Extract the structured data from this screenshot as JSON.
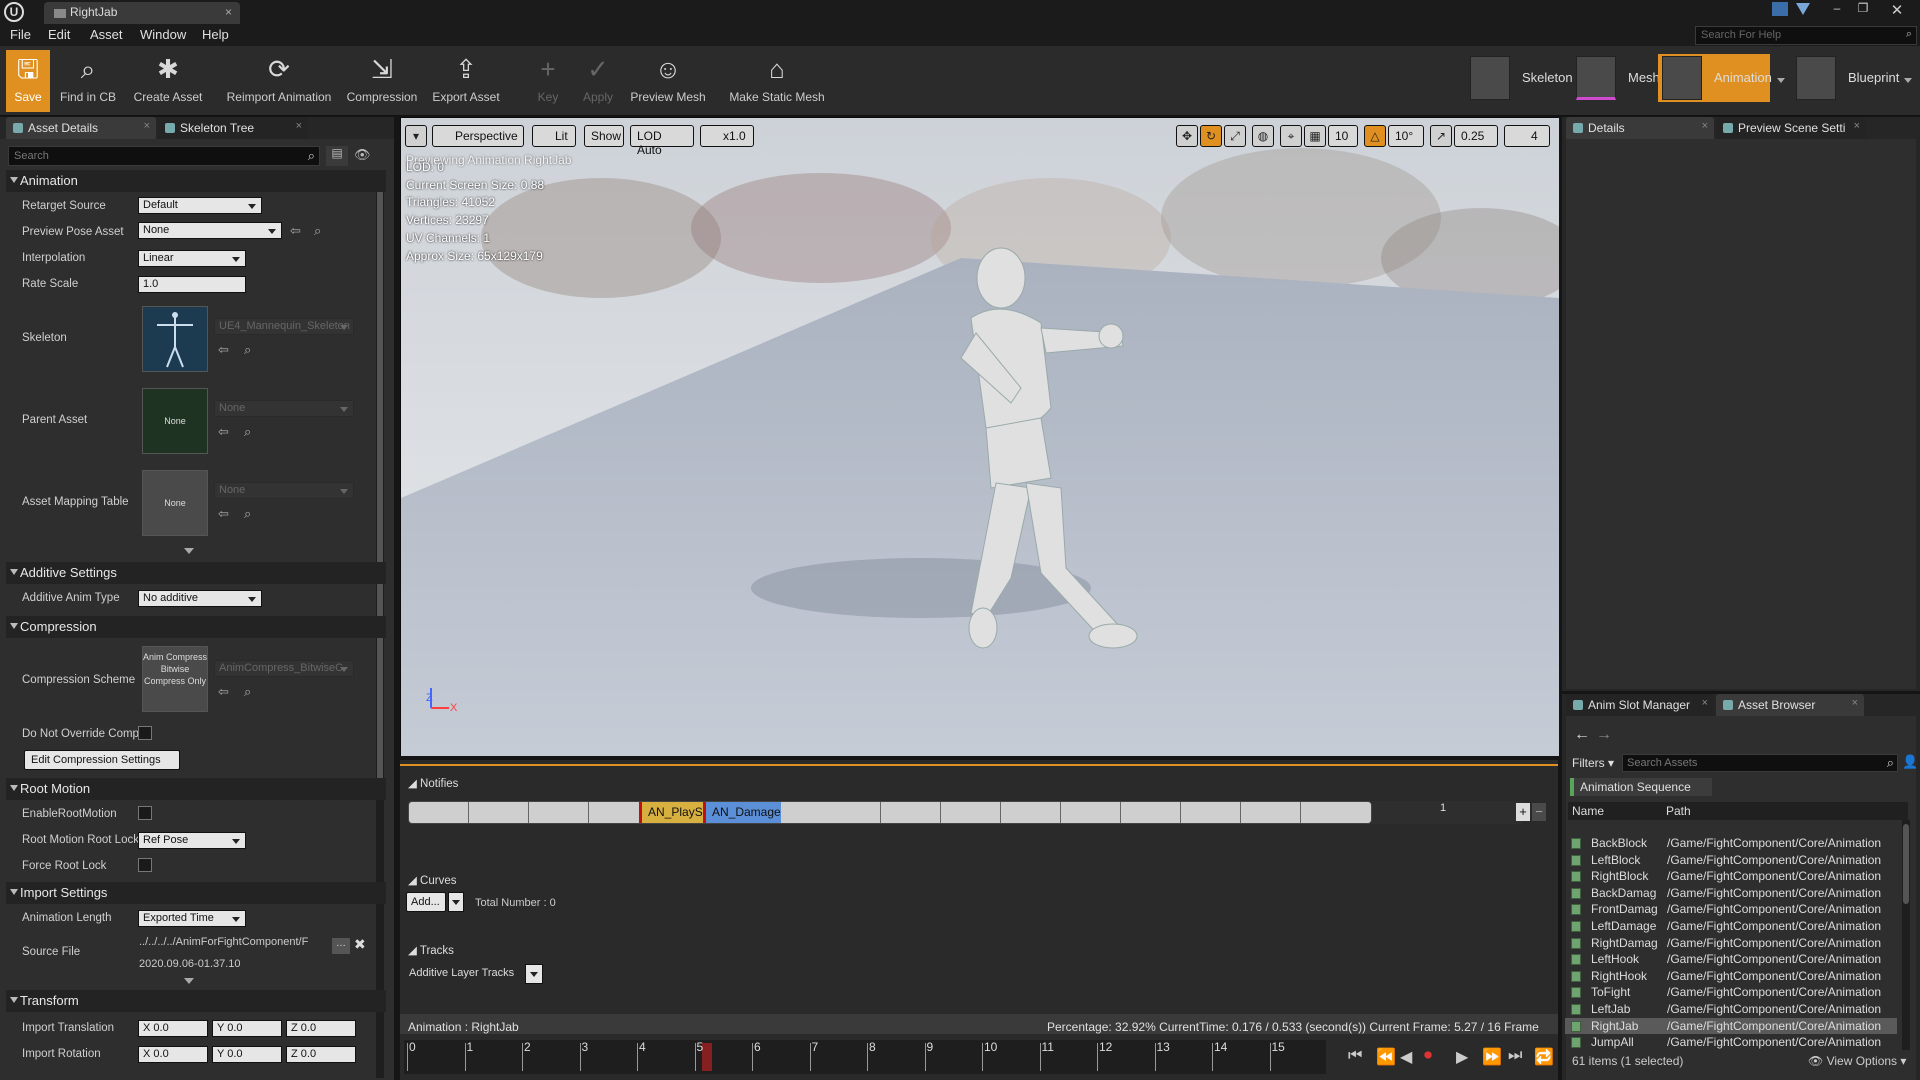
{
  "window": {
    "title": "RightJab"
  },
  "menu": [
    "File",
    "Edit",
    "Asset",
    "Window",
    "Help"
  ],
  "help_search_placeholder": "Search For Help",
  "toolbar": [
    "Save",
    "Find in CB",
    "Create Asset",
    "Reimport Animation",
    "Compression",
    "Export Asset",
    "Key",
    "Apply",
    "Preview Mesh",
    "Make Static Mesh"
  ],
  "modes": [
    "Skeleton",
    "Mesh",
    "Animation",
    "Blueprint"
  ],
  "left_panel": {
    "tabs": [
      "Asset Details",
      "Skeleton Tree"
    ],
    "search_placeholder": "Search",
    "sections": {
      "animation": "Animation",
      "additive": "Additive Settings",
      "compression": "Compression",
      "root_motion": "Root Motion",
      "import": "Import Settings",
      "transform": "Transform"
    },
    "props": {
      "retarget_source": {
        "label": "Retarget Source",
        "value": "Default"
      },
      "preview_pose": {
        "label": "Preview Pose Asset",
        "value": "None"
      },
      "interpolation": {
        "label": "Interpolation",
        "value": "Linear"
      },
      "rate_scale": {
        "label": "Rate Scale",
        "value": "1.0"
      },
      "skeleton": {
        "label": "Skeleton",
        "value": "UE4_Mannequin_Skeleton"
      },
      "parent_asset": {
        "label": "Parent Asset",
        "value": "None",
        "thumb": "None"
      },
      "asset_mapping": {
        "label": "Asset Mapping Table",
        "value": "None",
        "thumb": "None"
      },
      "additive_type": {
        "label": "Additive Anim Type",
        "value": "No additive"
      },
      "compression_scheme": {
        "label": "Compression Scheme",
        "value": "AnimCompress_BitwiseC",
        "thumb": "Anim Compress Bitwise Compress Only"
      },
      "do_not_override": {
        "label": "Do Not Override Comp"
      },
      "edit_compression": "Edit Compression Settings",
      "enable_root_motion": {
        "label": "EnableRootMotion"
      },
      "root_motion_lock": {
        "label": "Root Motion Root Lock",
        "value": "Ref Pose"
      },
      "force_root_lock": {
        "label": "Force Root Lock"
      },
      "anim_length": {
        "label": "Animation Length",
        "value": "Exported Time"
      },
      "source_file": {
        "label": "Source File",
        "value": "../../../../AnimForFightComponent/F",
        "date": "2020.09.06-01.37.10"
      },
      "import_translation": {
        "label": "Import Translation",
        "x": "0.0",
        "y": "0.0",
        "z": "0.0"
      },
      "import_rotation": {
        "label": "Import Rotation",
        "x": "0.0",
        "y": "0.0",
        "z": "0.0"
      }
    }
  },
  "viewport": {
    "buttons": [
      "Perspective",
      "Lit",
      "Show",
      "LOD Auto",
      "x1.0"
    ],
    "right_values": [
      "10",
      "10°",
      "0.25",
      "4"
    ],
    "previewing": "Previewing Animation RightJab",
    "stats": [
      "LOD: 0",
      "Current Screen Size: 0.88",
      "Triangles: 41052",
      "Vertices: 23297",
      "UV Channels: 1",
      "Approx Size: 65x129x179"
    ],
    "axis": {
      "z": "Z",
      "x": "X"
    }
  },
  "timeline": {
    "notifies_label": "Notifies",
    "notifies": [
      "AN_PlayS",
      "AN_Damage"
    ],
    "track_index": "1",
    "curves_label": "Curves",
    "add_label": "Add...",
    "total_number": "Total Number : 0",
    "tracks_label": "Tracks",
    "additive_layer": "Additive Layer Tracks",
    "anim_name": "Animation :  RightJab",
    "status": "Percentage:  32.92% CurrentTime:  0.176 / 0.533 (second(s)) Current Frame:  5.27 / 16 Frame",
    "ruler": [
      "0",
      "1",
      "2",
      "3",
      "4",
      "5",
      "6",
      "7",
      "8",
      "9",
      "10",
      "11",
      "12",
      "13",
      "14",
      "15"
    ]
  },
  "right_panel": {
    "tabs": [
      "Details",
      "Preview Scene Setti"
    ],
    "bottom_tabs": [
      "Anim Slot Manager",
      "Asset Browser"
    ],
    "filters": "Filters",
    "search_placeholder": "Search Assets",
    "filter_tag": "Animation Sequence",
    "columns": [
      "Name",
      "Path"
    ],
    "assets": [
      {
        "name": "BackBlock",
        "path": "/Game/FightComponent/Core/Animation"
      },
      {
        "name": "LeftBlock",
        "path": "/Game/FightComponent/Core/Animation"
      },
      {
        "name": "RightBlock",
        "path": "/Game/FightComponent/Core/Animation"
      },
      {
        "name": "BackDamag",
        "path": "/Game/FightComponent/Core/Animation"
      },
      {
        "name": "FrontDamag",
        "path": "/Game/FightComponent/Core/Animation"
      },
      {
        "name": "LeftDamage",
        "path": "/Game/FightComponent/Core/Animation"
      },
      {
        "name": "RightDamag",
        "path": "/Game/FightComponent/Core/Animation"
      },
      {
        "name": "LeftHook",
        "path": "/Game/FightComponent/Core/Animation"
      },
      {
        "name": "RightHook",
        "path": "/Game/FightComponent/Core/Animation"
      },
      {
        "name": "ToFight",
        "path": "/Game/FightComponent/Core/Animation"
      },
      {
        "name": "LeftJab",
        "path": "/Game/FightComponent/Core/Animation"
      },
      {
        "name": "RightJab",
        "path": "/Game/FightComponent/Core/Animation"
      },
      {
        "name": "JumpAll",
        "path": "/Game/FightComponent/Core/Animation"
      }
    ],
    "selected": "RightJab",
    "count": "61 items (1 selected)",
    "view_options": "View Options"
  }
}
